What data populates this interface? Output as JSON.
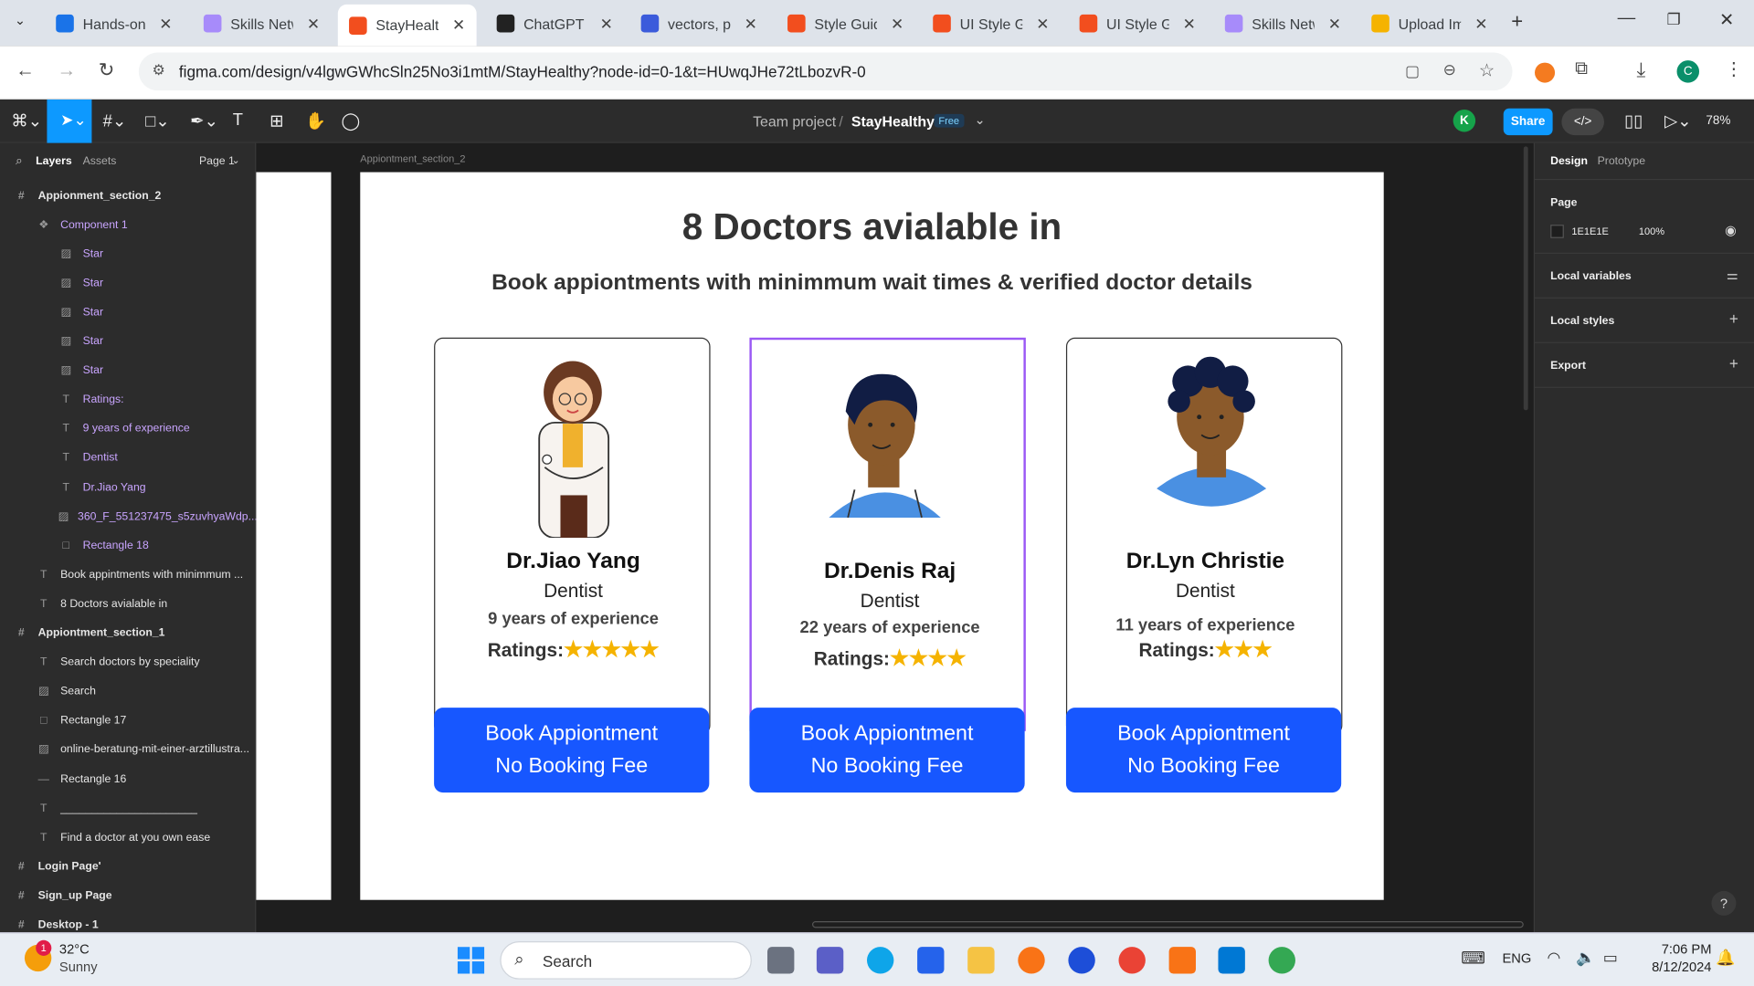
{
  "browser": {
    "tabs": [
      {
        "title": "Hands-on",
        "color": "#1a73e8"
      },
      {
        "title": "Skills Netw",
        "color": "#a78bfa"
      },
      {
        "title": "StayHealth",
        "color": "#f24e1e",
        "active": true
      },
      {
        "title": "ChatGPT",
        "color": "#222"
      },
      {
        "title": "vectors, ph",
        "color": "#3b5bdb"
      },
      {
        "title": "Style Guide",
        "color": "#f24e1e"
      },
      {
        "title": "UI Style Gu",
        "color": "#f24e1e"
      },
      {
        "title": "UI Style Gu",
        "color": "#f24e1e"
      },
      {
        "title": "Skills Netw",
        "color": "#a78bfa"
      },
      {
        "title": "Upload Im",
        "color": "#f5b300"
      }
    ],
    "url": "figma.com/design/v4lgwGWhcSln25No3i1mtM/StayHealthy?node-id=0-1&t=HUwqJHe72tLbozvR-0",
    "profile_initial": "C"
  },
  "figma": {
    "breadcrumb_team": "Team project",
    "breadcrumb_sep": "/",
    "file_name": "StayHealthy",
    "plan_badge": "Free",
    "share_label": "Share",
    "user_initial": "K",
    "zoom": "78%",
    "tab_layers": "Layers",
    "tab_assets": "Assets",
    "page_select": "Page 1",
    "layers": [
      {
        "name": "Appionment_section_2",
        "icon": "#",
        "style": "bold"
      },
      {
        "name": "Component 1",
        "icon": "❖",
        "style": "purple",
        "indent": 1
      },
      {
        "name": "Star",
        "icon": "▨",
        "style": "purple",
        "indent": 2
      },
      {
        "name": "Star",
        "icon": "▨",
        "style": "purple",
        "indent": 2
      },
      {
        "name": "Star",
        "icon": "▨",
        "style": "purple",
        "indent": 2
      },
      {
        "name": "Star",
        "icon": "▨",
        "style": "purple",
        "indent": 2
      },
      {
        "name": "Star",
        "icon": "▨",
        "style": "purple",
        "indent": 2
      },
      {
        "name": "Ratings:",
        "icon": "T",
        "style": "purple",
        "indent": 2
      },
      {
        "name": "9 years of experience",
        "icon": "T",
        "style": "purple",
        "indent": 2
      },
      {
        "name": "Dentist",
        "icon": "T",
        "style": "purple",
        "indent": 2
      },
      {
        "name": "Dr.Jiao Yang",
        "icon": "T",
        "style": "purple",
        "indent": 2
      },
      {
        "name": "360_F_551237475_s5zuvhyaWdp...",
        "icon": "▨",
        "style": "purple",
        "indent": 2
      },
      {
        "name": "Rectangle 18",
        "icon": "□",
        "style": "purple",
        "indent": 2
      },
      {
        "name": "Book appintments with minimmum ...",
        "icon": "T",
        "style": "",
        "indent": 1
      },
      {
        "name": "8 Doctors avialable in",
        "icon": "T",
        "style": "",
        "indent": 1
      },
      {
        "name": "Appiontment_section_1",
        "icon": "#",
        "style": "bold"
      },
      {
        "name": "Search doctors by speciality",
        "icon": "T",
        "style": "",
        "indent": 1
      },
      {
        "name": "Search",
        "icon": "▨",
        "style": "",
        "indent": 1
      },
      {
        "name": "Rectangle 17",
        "icon": "□",
        "style": "",
        "indent": 1
      },
      {
        "name": "online-beratung-mit-einer-arztillustra...",
        "icon": "▨",
        "style": "",
        "indent": 1
      },
      {
        "name": "Rectangle 16",
        "icon": "—",
        "style": "",
        "indent": 1
      },
      {
        "name": "______________________",
        "icon": "T",
        "style": "",
        "indent": 1
      },
      {
        "name": "Find a doctor at you own ease",
        "icon": "T",
        "style": "",
        "indent": 1
      },
      {
        "name": "Login Page'",
        "icon": "#",
        "style": "bold"
      },
      {
        "name": "Sign_up Page",
        "icon": "#",
        "style": "bold"
      },
      {
        "name": "Desktop - 1",
        "icon": "#",
        "style": "bold"
      }
    ],
    "right_tabs": {
      "design": "Design",
      "prototype": "Prototype"
    },
    "page_section": "Page",
    "page_color": "1E1E1E",
    "page_opacity": "100%",
    "local_variables": "Local variables",
    "local_styles": "Local styles",
    "export": "Export",
    "frame_label": "Appiontment_section_2"
  },
  "design": {
    "heading": "8 Doctors avialable in",
    "subheading": "Book appiontments with minimmum wait times & verified doctor details",
    "doctors": [
      {
        "name": "Dr.Jiao Yang",
        "specialty": "Dentist",
        "experience": "9 years of experience",
        "ratings_label": "Ratings:",
        "stars": 5,
        "button_line1": "Book Appiontment",
        "button_line2": "No Booking Fee"
      },
      {
        "name": "Dr.Denis Raj",
        "specialty": "Dentist",
        "experience": "22 years of experience",
        "ratings_label": "Ratings:",
        "stars": 4,
        "button_line1": "Book Appiontment",
        "button_line2": "No Booking Fee"
      },
      {
        "name": "Dr.Lyn Christie",
        "specialty": "Dentist",
        "experience": "11 years of experience",
        "ratings_label": "Ratings:",
        "stars": 3,
        "button_line1": "Book Appiontment",
        "button_line2": "No Booking Fee"
      }
    ]
  },
  "taskbar": {
    "temperature": "32°C",
    "weather": "Sunny",
    "weather_badge": "1",
    "search_label": "Search",
    "language": "ENG",
    "time": "7:06 PM",
    "date": "8/12/2024"
  }
}
